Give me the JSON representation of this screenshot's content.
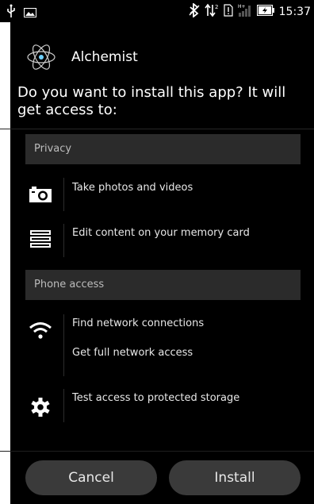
{
  "status_bar": {
    "time": "15:37",
    "icons": [
      "usb-icon",
      "image-icon",
      "bluetooth-icon",
      "data-transfer-icon",
      "sim-alert-icon",
      "signal-icon",
      "battery-icon"
    ]
  },
  "app": {
    "name": "Alchemist",
    "logo_icon": "atom-icon"
  },
  "question": "Do you want to install this app? It will get access to:",
  "sections": {
    "privacy": {
      "title": "Privacy",
      "items": [
        {
          "icon": "camera-icon",
          "label": "Take photos and videos"
        },
        {
          "icon": "memory-card-icon",
          "label": "Edit content on your memory card"
        }
      ]
    },
    "phone_access": {
      "title": "Phone access",
      "items": [
        {
          "icon": "wifi-icon",
          "labels": [
            "Find network connections",
            "Get full network access"
          ]
        },
        {
          "icon": "gear-icon",
          "label": "Test access to protected storage"
        }
      ]
    }
  },
  "buttons": {
    "cancel": "Cancel",
    "install": "Install"
  },
  "colors": {
    "background": "#000000",
    "section_bg": "#2b2b2b",
    "button_bg": "#3a3a3a",
    "text": "#ffffff"
  }
}
